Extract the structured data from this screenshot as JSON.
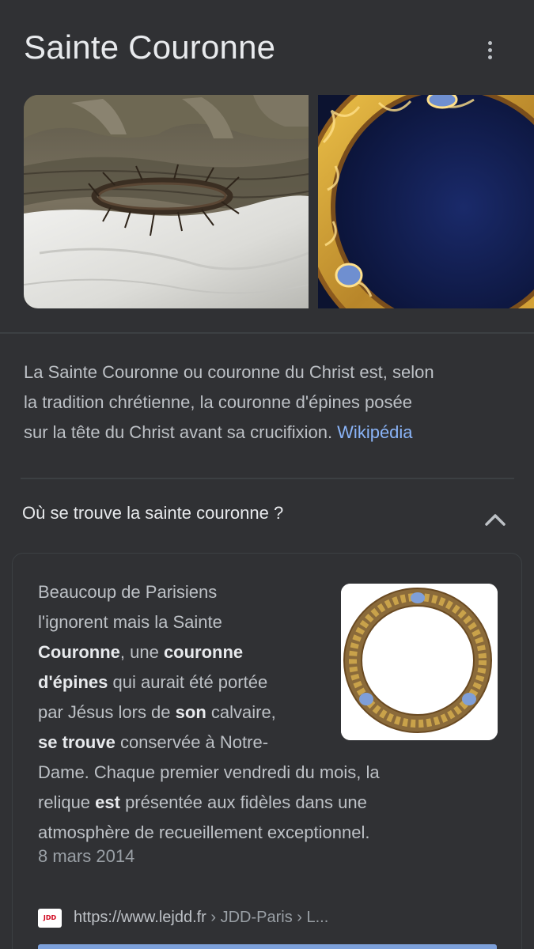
{
  "header": {
    "title": "Sainte Couronne"
  },
  "images": [
    {
      "name": "crown-of-thorns-on-cloth"
    },
    {
      "name": "golden-reliquary"
    }
  ],
  "description": {
    "text": "La Sainte Couronne ou couronne du Christ est, selon la tradition chrétienne, la couronne d'épines posée sur la tête du Christ avant sa crucifixion. ",
    "lines": [
      "La Sainte Couronne ou couronne du Christ est, selon",
      "la tradition chrétienne, la couronne d'épines posée",
      "sur la tête du Christ avant sa crucifixion. "
    ],
    "source_link": "Wikipédia"
  },
  "question": {
    "text": "Où se trouve la sainte couronne ?",
    "expanded": true
  },
  "answer": {
    "lines": [
      [
        {
          "t": "Beaucoup de Parisiens",
          "b": false
        }
      ],
      [
        {
          "t": "l'ignorent mais la Sainte",
          "b": false
        }
      ],
      [
        {
          "t": "Couronne",
          "b": true
        },
        {
          "t": ", une ",
          "b": false
        },
        {
          "t": "couronne",
          "b": true
        }
      ],
      [
        {
          "t": "d'épines",
          "b": true
        },
        {
          "t": " qui aurait été portée",
          "b": false
        }
      ],
      [
        {
          "t": "par Jésus lors de ",
          "b": false
        },
        {
          "t": "son",
          "b": true
        },
        {
          "t": " calvaire,",
          "b": false
        }
      ],
      [
        {
          "t": "se trouve",
          "b": true
        },
        {
          "t": " conservée à Notre-",
          "b": false
        }
      ],
      [
        {
          "t": "Dame. Chaque premier vendredi du mois, la",
          "b": false
        }
      ],
      [
        {
          "t": "relique ",
          "b": false
        },
        {
          "t": "est",
          "b": true
        },
        {
          "t": " présentée aux fidèles dans une",
          "b": false
        }
      ],
      [
        {
          "t": "atmosphère de recueillement exceptionnel.",
          "b": false
        }
      ]
    ],
    "date": "8 mars 2014",
    "source": {
      "favicon_text": "JDD",
      "url": "https://www.lejdd.fr",
      "breadcrumb": " › JDD-Paris › L..."
    }
  },
  "colors": {
    "background": "#303134",
    "text": "#bdc1c6",
    "title": "#e8eaed",
    "link": "#8ab4f8",
    "divider": "#3c4043"
  }
}
